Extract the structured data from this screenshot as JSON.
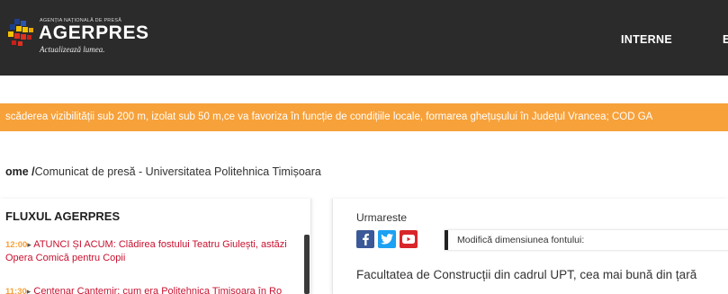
{
  "header": {
    "logo": {
      "agency": "AGENȚIA NAȚIONALĂ DE PRESĂ",
      "brand": "AGERPRES",
      "tagline": "Actualizează lumea."
    },
    "nav": [
      {
        "label": "INTERNE"
      },
      {
        "label": "E"
      }
    ]
  },
  "ticker": {
    "text": "scăderea vizibilității sub 200 m, izolat sub 50 m,ce va favoriza în funcție de condițiile locale, formarea ghețușului în Județul Vrancea; COD GA"
  },
  "breadcrumb": {
    "home": "ome /",
    "current": "Comunicat de presă - Universitatea Politehnica Timișoara"
  },
  "feed": {
    "title": "FLUXUL AGERPRES",
    "items": [
      {
        "time": "12:00",
        "arrow": "▸",
        "text": " ATUNCI ȘI ACUM: Clădirea fostului Teatru Giulești, astăzi Opera Comică pentru Copii"
      },
      {
        "time": "11:30",
        "arrow": "▸",
        "text": " Centenar Cantemir: cum era Politehnica Timișoara în Ro"
      }
    ]
  },
  "article": {
    "follow_label": "Urmareste",
    "social_icons": [
      "facebook-icon",
      "twitter-icon",
      "youtube-icon"
    ],
    "font_size_label": "Modifică dimensiunea fontului:",
    "lead": "Facultatea de Construcții din cadrul UPT, cea mai bună din țară"
  },
  "colors": {
    "header_bg": "#2b2b2b",
    "ticker_bg": "#f7a13a",
    "feed_link": "#c8102e",
    "feed_time": "#f7a13a",
    "facebook": "#3b5998",
    "twitter": "#1da1f2",
    "youtube": "#d8262a"
  }
}
